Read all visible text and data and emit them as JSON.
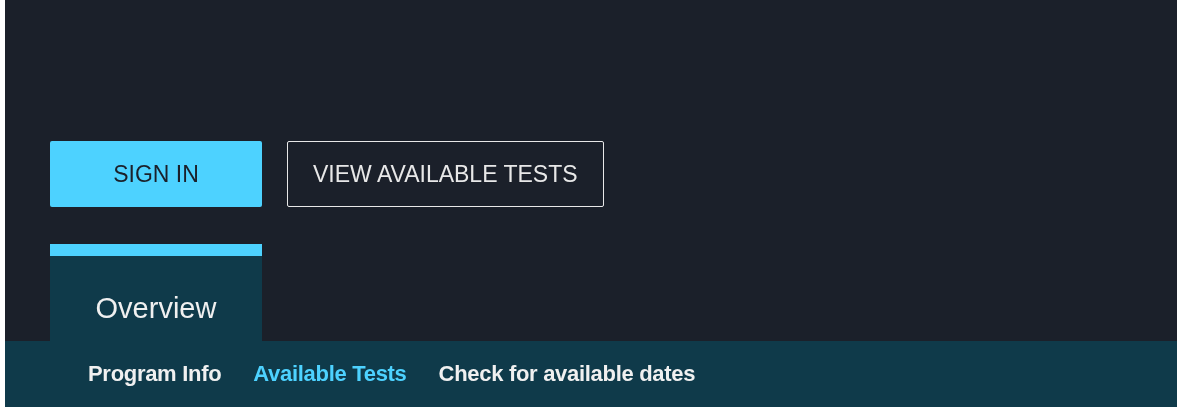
{
  "buttons": [
    {
      "label": "SIGN IN",
      "kind": "primary"
    },
    {
      "label": "VIEW AVAILABLE TESTS",
      "kind": "outline"
    }
  ],
  "tabs": [
    {
      "label": "Overview",
      "selected": true
    }
  ],
  "subnav": [
    {
      "label": "Program Info",
      "selected": false
    },
    {
      "label": "Available Tests",
      "selected": true
    },
    {
      "label": "Check for available dates",
      "selected": false
    }
  ]
}
